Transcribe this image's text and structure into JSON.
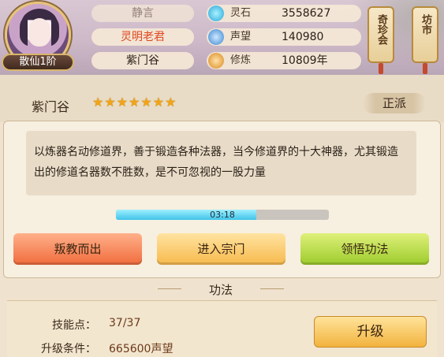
{
  "player": {
    "rank_badge": "散仙1阶",
    "name_top": "静言",
    "name_main": "灵明老君",
    "sect_name": "紫门谷"
  },
  "stats": [
    {
      "icon": "spirit-stone-icon",
      "label": "灵石",
      "value": "3558627"
    },
    {
      "icon": "reputation-icon",
      "label": "声望",
      "value": "140980"
    },
    {
      "icon": "cultivation-icon",
      "label": "修炼",
      "value": "10809年"
    }
  ],
  "side_buttons": [
    {
      "label": "奇珍会"
    },
    {
      "label": "坊市"
    }
  ],
  "sect": {
    "name": "紫门谷",
    "stars": "★★★★★★★",
    "faction": "正派",
    "description": "以炼器名动修道界，善于锻造各种法器，当今修道界的十大神器，尤其锻造出的修道名器数不胜数，是不可忽视的一股力量",
    "timer": "03:18",
    "timer_progress": 0.66
  },
  "actions": {
    "betray": "叛教而出",
    "enter": "进入宗门",
    "learn": "领悟功法"
  },
  "skills": {
    "section_title": "功法",
    "points_label": "技能点：",
    "points_value": "37/37",
    "condition_label": "升级条件：",
    "condition_value": "665600声望",
    "upgrade_label": "升级"
  },
  "colors": {
    "stars": "#f1a417",
    "progress_fill": "#3fc3e9",
    "betray_button": "#f06c3c",
    "enter_button": "#f7b94c",
    "learn_button": "#9ccb2b"
  }
}
